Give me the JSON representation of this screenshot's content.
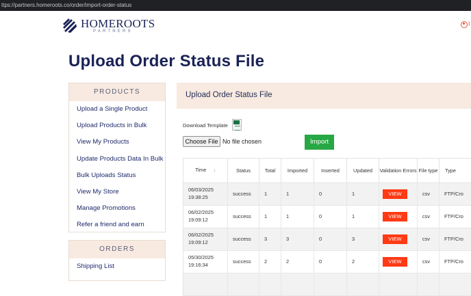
{
  "browser": {
    "url": "ttps://partners.homeroots.co/order/import-order-status"
  },
  "header": {
    "logo_name": "HOMEROOTS",
    "logo_sub": "PARTNERS",
    "user_initial": "I"
  },
  "page_title": "Upload Order Status File",
  "sidebar": {
    "products_heading": "PRODUCTS",
    "products": [
      "Upload a Single Product",
      "Upload Products in Bulk",
      "View My Products",
      "Update Products Data In Bulk",
      "Bulk Uploads Status",
      "View My Store",
      "Manage Promotions",
      "Refer a friend and earn"
    ],
    "orders_heading": "ORDERS",
    "orders": [
      "Shipping List"
    ]
  },
  "panel": {
    "title": "Upload Order Status File",
    "download_label": "Download Template",
    "choose_file_label": "Choose File",
    "no_file_text": "No file chosen",
    "import_label": "Import"
  },
  "table": {
    "headers": [
      "Time",
      "Status",
      "Total",
      "Imported",
      "Inserted",
      "Updated",
      "Validation Errors",
      "File type",
      "Type"
    ],
    "rows": [
      {
        "date": "06/03/2025",
        "time": "19:38:25",
        "status": "success",
        "total": "1",
        "imported": "1",
        "inserted": "0",
        "updated": "1",
        "errors": "VIEW",
        "filetype": "csv",
        "type": "FTP/Cro"
      },
      {
        "date": "06/02/2025",
        "time": "19:09:12",
        "status": "success",
        "total": "1",
        "imported": "1",
        "inserted": "0",
        "updated": "1",
        "errors": "VIEW",
        "filetype": "csv",
        "type": "FTP/Cro"
      },
      {
        "date": "06/02/2025",
        "time": "19:09:12",
        "status": "success",
        "total": "3",
        "imported": "3",
        "inserted": "0",
        "updated": "3",
        "errors": "VIEW",
        "filetype": "csv",
        "type": "FTP/Cro"
      },
      {
        "date": "05/30/2025",
        "time": "19:16:34",
        "status": "success",
        "total": "2",
        "imported": "2",
        "inserted": "0",
        "updated": "2",
        "errors": "VIEW",
        "filetype": "csv",
        "type": "FTP/Cro"
      }
    ]
  },
  "colors": {
    "accent": "#f8eae0",
    "navy": "#1a2255",
    "import_green": "#28a745",
    "view_red": "#ff3a14"
  }
}
